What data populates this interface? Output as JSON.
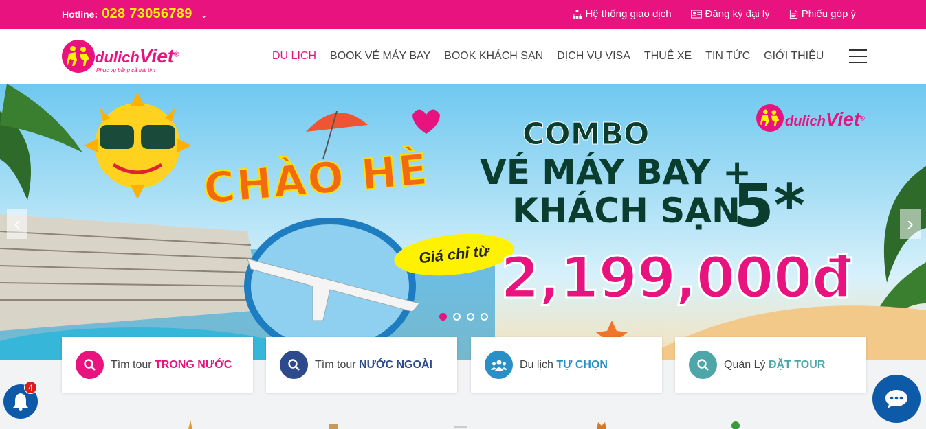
{
  "topbar": {
    "hotline_label": "Hotline:",
    "hotline_number": "028 73056789",
    "links": [
      {
        "label": "Hệ thống giao dịch",
        "icon": "sitemap-icon"
      },
      {
        "label": "Đăng ký đại lý",
        "icon": "id-card-icon"
      },
      {
        "label": "Phiếu góp ý",
        "icon": "document-icon"
      }
    ],
    "color": "#e8137e",
    "hotline_color": "#fff200"
  },
  "logo": {
    "name_prefix": "dulich",
    "name_suffix": "Viet",
    "registered": "®",
    "slogan": "Phục vụ bằng cả trái tim"
  },
  "nav": {
    "items": [
      "DU LỊCH",
      "BOOK VÉ MÁY BAY",
      "BOOK KHÁCH SẠN",
      "DỊCH VỤ VISA",
      "THUÊ XE",
      "TIN TỨC",
      "GIỚI THIỆU"
    ],
    "active_index": 0
  },
  "banner": {
    "headline": "CHÀO HÈ",
    "combo": "COMBO",
    "line1": "VÉ MÁY BAY +",
    "line2": "KHÁCH SẠN",
    "stars": "5*",
    "price_prefix": "Giá chỉ từ",
    "price": "2,199,000đ",
    "slide_count": 4,
    "active_slide": 0
  },
  "search_cards": [
    {
      "prefix": "Tìm tour",
      "highlight": "TRONG NƯỚC",
      "icon": "search-icon",
      "color": "#e8137e"
    },
    {
      "prefix": "Tìm tour",
      "highlight": "NƯỚC NGOÀI",
      "icon": "search-icon",
      "color": "#2c4a8c"
    },
    {
      "prefix": "Du lịch",
      "highlight": "TỰ CHỌN",
      "icon": "users-icon",
      "color": "#2a8fc4"
    },
    {
      "prefix": "Quản Lý",
      "highlight": "ĐẶT TOUR",
      "icon": "search-icon",
      "color": "#4fa6a8"
    }
  ],
  "notifications": {
    "count": "4"
  }
}
